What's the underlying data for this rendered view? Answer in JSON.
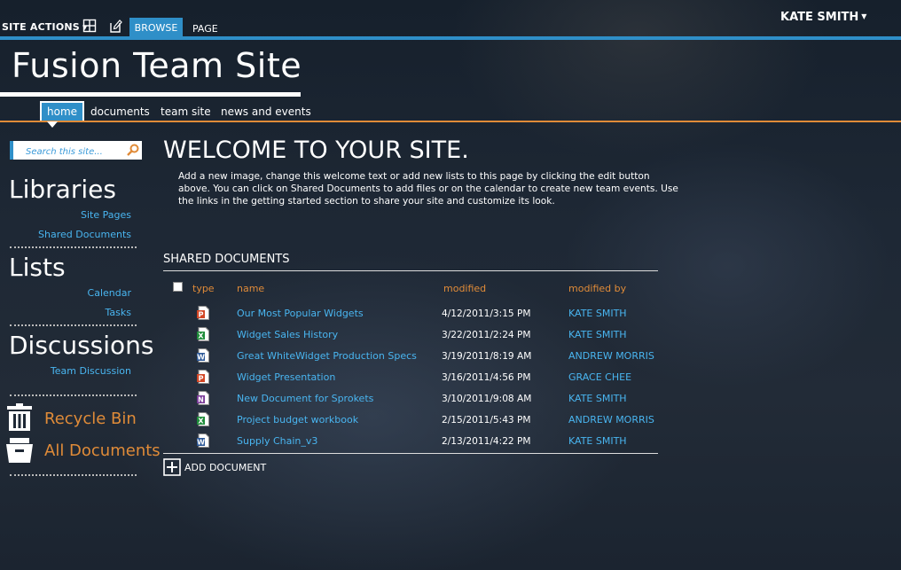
{
  "ribbon": {
    "site_actions": "SITE ACTIONS",
    "tabs": [
      {
        "label": "BROWSE"
      },
      {
        "label": "PAGE"
      }
    ],
    "user": "KATE SMITH"
  },
  "site": {
    "title": "Fusion Team Site"
  },
  "topnav": [
    {
      "label": "home"
    },
    {
      "label": "documents"
    },
    {
      "label": "team site"
    },
    {
      "label": "news and events"
    }
  ],
  "search": {
    "placeholder": "Search this site..."
  },
  "quicklaunch": {
    "libraries": {
      "heading": "Libraries",
      "items": [
        "Site Pages",
        "Shared Documents"
      ]
    },
    "lists": {
      "heading": "Lists",
      "items": [
        "Calendar",
        "Tasks"
      ]
    },
    "discussions": {
      "heading": "Discussions",
      "items": [
        "Team Discussion"
      ]
    },
    "recycle_bin": "Recycle Bin",
    "all_documents": "All Documents"
  },
  "main": {
    "welcome_title": "WELCOME TO YOUR SITE.",
    "intro": "Add a new image, change this welcome text or add new lists to this page by clicking the edit button above. You can click on Shared Documents to add files or on the calendar to create new team events. Use the links in the getting started section to share your site and customize its look.",
    "shared_documents": {
      "title": "SHARED DOCUMENTS",
      "headers": {
        "type": "type",
        "name": "name",
        "modified": "modified",
        "modified_by": "modified by"
      },
      "rows": [
        {
          "icon": "powerpoint-icon",
          "name": "Our Most Popular Widgets",
          "modified": "4/12/2011/3:15 PM",
          "modified_by": "KATE SMITH"
        },
        {
          "icon": "excel-icon",
          "name": "Widget Sales History",
          "modified": "3/22/2011/2:24 PM",
          "modified_by": "KATE SMITH"
        },
        {
          "icon": "word-icon",
          "name": "Great WhiteWidget Production Specs",
          "modified": "3/19/2011/8:19 AM",
          "modified_by": "ANDREW MORRIS"
        },
        {
          "icon": "powerpoint-icon",
          "name": "Widget Presentation",
          "modified": "3/16/2011/4:56 PM",
          "modified_by": "GRACE CHEE"
        },
        {
          "icon": "onenote-icon",
          "name": "New Document for Sprokets",
          "modified": "3/10/2011/9:08 AM",
          "modified_by": "KATE SMITH"
        },
        {
          "icon": "excel-icon",
          "name": "Project budget workbook",
          "modified": "2/15/2011/5:43 PM",
          "modified_by": "ANDREW MORRIS"
        },
        {
          "icon": "word-icon",
          "name": "Supply Chain_v3",
          "modified": "2/13/2011/4:22 PM",
          "modified_by": "KATE SMITH"
        }
      ],
      "add_label": "ADD DOCUMENT"
    }
  },
  "colors": {
    "accent_blue": "#2f8fc8",
    "link_blue": "#49b5f0",
    "accent_orange": "#e08b38"
  }
}
